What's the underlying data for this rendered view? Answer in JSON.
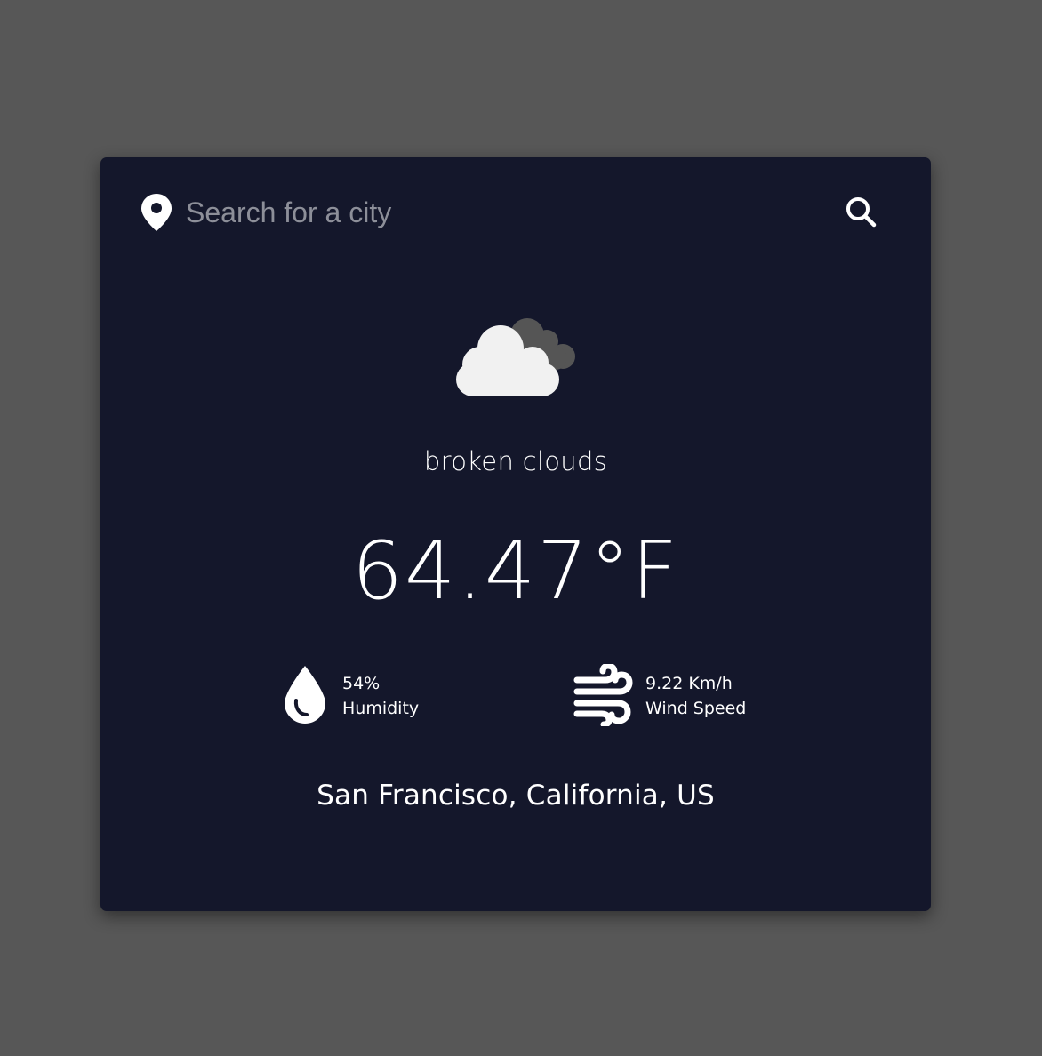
{
  "search": {
    "placeholder": "Search for a city",
    "value": "",
    "location_icon": "map-pin-icon",
    "search_icon": "magnifier-icon"
  },
  "weather": {
    "icon": "broken-clouds-icon",
    "description": "broken clouds",
    "temperature": "64.47°F"
  },
  "stats": {
    "humidity": {
      "icon": "water-drop-icon",
      "value": "54%",
      "label": "Humidity"
    },
    "wind": {
      "icon": "wind-icon",
      "value": "9.22 Km/h",
      "label": "Wind Speed"
    }
  },
  "location": "San Francisco, California, US",
  "colors": {
    "page_background": "#575757",
    "card_background": "#14172b",
    "text": "#ffffff",
    "placeholder_text": "#8d8f99",
    "cloud_front": "#f1f1f1",
    "cloud_back": "#555555"
  }
}
